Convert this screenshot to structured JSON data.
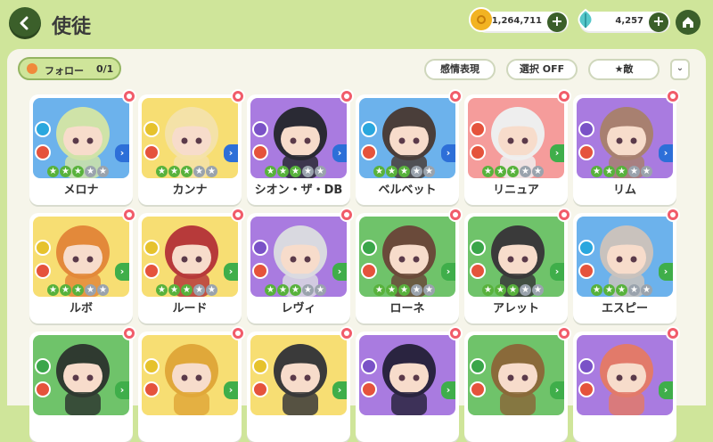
{
  "header": {
    "title": "使徒",
    "coins": "1,264,711",
    "gems": "4,257"
  },
  "toolbar": {
    "follow_label": "フォロー",
    "follow_count": "0/1",
    "emotion_label": "感情表現",
    "select_label": "選択 OFF",
    "enemy_label": "★敵"
  },
  "colors": {
    "background": "#cfe59a",
    "panel": "#f6f5ea",
    "dark_green": "#3b5f2a",
    "card_yellow": "#f7de73",
    "card_blue": "#6cb2ec",
    "card_purple": "#a97be0",
    "card_pink": "#f59c9b",
    "card_green": "#6fc36a"
  },
  "characters": [
    {
      "name": "メロナ",
      "bg": "#6cb2ec",
      "stars": 3,
      "attr_color": "#2aa7de",
      "arrow_color": "#2d6fd8",
      "hair": "#cfe3a8"
    },
    {
      "name": "カンナ",
      "bg": "#f7de73",
      "stars": 3,
      "attr_color": "#e6c22c",
      "arrow_color": "#2d6fd8",
      "hair": "#f4e2a8"
    },
    {
      "name": "シオン・ザ・DB",
      "bg": "#a97be0",
      "stars": 3,
      "attr_color": "#7a52c7",
      "arrow_color": "#2d6fd8",
      "hair": "#2a2a34"
    },
    {
      "name": "ベルベット",
      "bg": "#6cb2ec",
      "stars": 3,
      "attr_color": "#2aa7de",
      "arrow_color": "#2d6fd8",
      "hair": "#4a3e3a"
    },
    {
      "name": "リニュア",
      "bg": "#f59c9b",
      "stars": 3,
      "attr_color": "#e5533c",
      "arrow_color": "#3fae4a",
      "hair": "#eeeeee"
    },
    {
      "name": "リム",
      "bg": "#a97be0",
      "stars": 3,
      "attr_color": "#7a52c7",
      "arrow_color": "#2d6fd8",
      "hair": "#a88070"
    },
    {
      "name": "ルボ",
      "bg": "#f7de73",
      "stars": 3,
      "attr_color": "#e6c22c",
      "arrow_color": "#3fae4a",
      "hair": "#e3893a"
    },
    {
      "name": "ルード",
      "bg": "#f7de73",
      "stars": 3,
      "attr_color": "#e6c22c",
      "arrow_color": "#3fae4a",
      "hair": "#b73a3a"
    },
    {
      "name": "レヴィ",
      "bg": "#a97be0",
      "stars": 3,
      "attr_color": "#7a52c7",
      "arrow_color": "#3fae4a",
      "hair": "#d9d9e0"
    },
    {
      "name": "ローネ",
      "bg": "#6fc36a",
      "stars": 3,
      "attr_color": "#3aa64a",
      "arrow_color": "#3fae4a",
      "hair": "#6a4a3a"
    },
    {
      "name": "アレット",
      "bg": "#6fc36a",
      "stars": 3,
      "attr_color": "#3aa64a",
      "arrow_color": "#3fae4a",
      "hair": "#3a3a3a"
    },
    {
      "name": "エスピー",
      "bg": "#6cb2ec",
      "stars": 3,
      "attr_color": "#2aa7de",
      "arrow_color": "#3fae4a",
      "hair": "#c9c2bd"
    },
    {
      "name": "",
      "bg": "#6fc36a",
      "stars": 0,
      "attr_color": "#3aa64a",
      "arrow_color": "#3fae4a",
      "hair": "#2f3a30"
    },
    {
      "name": "",
      "bg": "#f7de73",
      "stars": 0,
      "attr_color": "#e6c22c",
      "arrow_color": "#3fae4a",
      "hair": "#e0a83a"
    },
    {
      "name": "",
      "bg": "#f7de73",
      "stars": 0,
      "attr_color": "#e6c22c",
      "arrow_color": "#3fae4a",
      "hair": "#3a3a3a"
    },
    {
      "name": "",
      "bg": "#a97be0",
      "stars": 0,
      "attr_color": "#7a52c7",
      "arrow_color": "#3fae4a",
      "hair": "#2a2440"
    },
    {
      "name": "",
      "bg": "#6fc36a",
      "stars": 0,
      "attr_color": "#3aa64a",
      "arrow_color": "#3fae4a",
      "hair": "#8a6a3a"
    },
    {
      "name": "",
      "bg": "#a97be0",
      "stars": 0,
      "attr_color": "#7a52c7",
      "arrow_color": "#3fae4a",
      "hair": "#e27a6a"
    }
  ]
}
